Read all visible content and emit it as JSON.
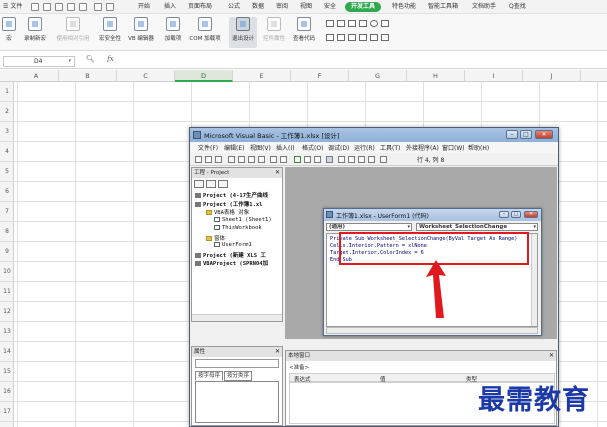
{
  "wps": {
    "menu_tabs": [
      "开始",
      "插入",
      "页面布局",
      "公式",
      "数据",
      "审阅",
      "视图",
      "安全",
      "开发工具",
      "特色功能",
      "智能工具箱",
      "文档助手"
    ],
    "active_tab": "开发工具",
    "file_menu": "文件",
    "search_label": "Q查找",
    "ribbon_buttons": [
      "宏",
      "录制新宏",
      "使用相对引用",
      "宏安全性",
      "VB 编辑器",
      "加载项",
      "COM 加载项",
      "退出设计",
      "控件属性",
      "查看代码"
    ],
    "name_box": "D4",
    "fx_label": "fx",
    "columns": [
      "A",
      "B",
      "C",
      "D",
      "E",
      "F",
      "G",
      "H",
      "I",
      "J"
    ],
    "selected_column": "D",
    "rows": [
      "1",
      "2",
      "3",
      "4",
      "5",
      "6",
      "7",
      "8",
      "9",
      "10",
      "11",
      "12",
      "13",
      "14",
      "15",
      "16",
      "17"
    ]
  },
  "vbe": {
    "title": "Microsoft Visual Basic - 工作簿1.xlsx [设计]",
    "menu": [
      "文件(F)",
      "编辑(E)",
      "视图(V)",
      "插入(I)",
      "格式(O)",
      "调试(D)",
      "运行(R)",
      "工具(T)",
      "外接程序(A)",
      "窗口(W)",
      "帮助(H)"
    ],
    "cursor_position": "行 4, 列 8",
    "project_pane": {
      "title": "工程 - Project",
      "tree": [
        {
          "text": "Project (4-17生产曲线",
          "kind": "root"
        },
        {
          "text": "Project (工作簿1.xl",
          "kind": "root"
        },
        {
          "text": "VBA表格 对象",
          "kind": "folder"
        },
        {
          "text": "Sheet1 (Sheet1)",
          "kind": "sheet"
        },
        {
          "text": "ThisWorkbook",
          "kind": "sheet"
        },
        {
          "text": "窗体",
          "kind": "folder"
        },
        {
          "text": "UserForm1",
          "kind": "sheet"
        },
        {
          "text": "Project (新建 XLS 工",
          "kind": "root"
        },
        {
          "text": "VBAProject (SPRN04加",
          "kind": "root"
        }
      ]
    },
    "properties_pane": {
      "title": "属性",
      "tabs": [
        "按字母序",
        "按分类序"
      ]
    },
    "code_window": {
      "title": "工作簿1.xlsx - UserForm1 (代码)",
      "object_combo": "(通用)",
      "procedure_combo": "Worksheet_SelectionChange",
      "lines": [
        "Private Sub Worksheet_SelectionChange(ByVal Target As Range)",
        "Cells.Interior.Pattern = xlNone",
        "Target.Interior.ColorIndex = 6",
        "End Sub"
      ]
    },
    "watch_pane": {
      "title": "本地窗口",
      "context": "<准备>",
      "columns": [
        "表达式",
        "值",
        "类型"
      ]
    }
  },
  "watermark": "最需教育",
  "colors": {
    "wps_green": "#2fa84f",
    "highlight_red": "#e0191e",
    "watermark_blue": "#1b3aa8",
    "vbe_title": "#a9c3e2"
  }
}
